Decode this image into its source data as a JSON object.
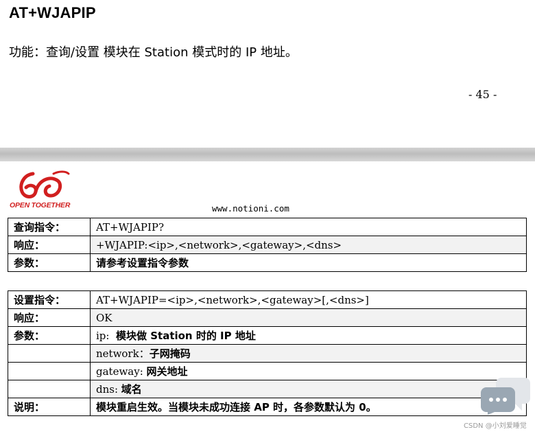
{
  "heading": "AT+WJAPIP",
  "description": "功能：查询/设置 模块在 Station 模式时的 IP 地址。",
  "page_number": "- 45 -",
  "logo": {
    "text": "OPEN TOGETHER",
    "color": "#d11f1f"
  },
  "website": "www.notioni.com",
  "query_table": [
    {
      "label": "查询指令：",
      "value": "AT+WJAPIP?"
    },
    {
      "label": "响应：",
      "value": "+WJAPIP:<ip>,<network>,<gateway>,<dns>"
    },
    {
      "label": "参数：",
      "value": "请参考设置指令参数"
    }
  ],
  "set_table": {
    "command": {
      "label": "设置指令：",
      "value": "AT+WJAPIP=<ip>,<network>,<gateway>[,<dns>]"
    },
    "response": {
      "label": "响应：",
      "value": "OK"
    },
    "params_label": "参数：",
    "params": [
      {
        "name": "ip:",
        "desc": "模块做 Station 时的 IP 地址"
      },
      {
        "name": "network：",
        "desc": "子网掩码"
      },
      {
        "name": "gateway:",
        "desc": "网关地址"
      },
      {
        "name": "dns:",
        "desc": "域名"
      }
    ],
    "note": {
      "label": "说明：",
      "value": "模块重启生效。当模块未成功连接 AP 时，各参数默认为 0。"
    }
  },
  "watermark": "CSDN @小刘爱睡觉",
  "watermark_icon": "chat-bubble-icon"
}
